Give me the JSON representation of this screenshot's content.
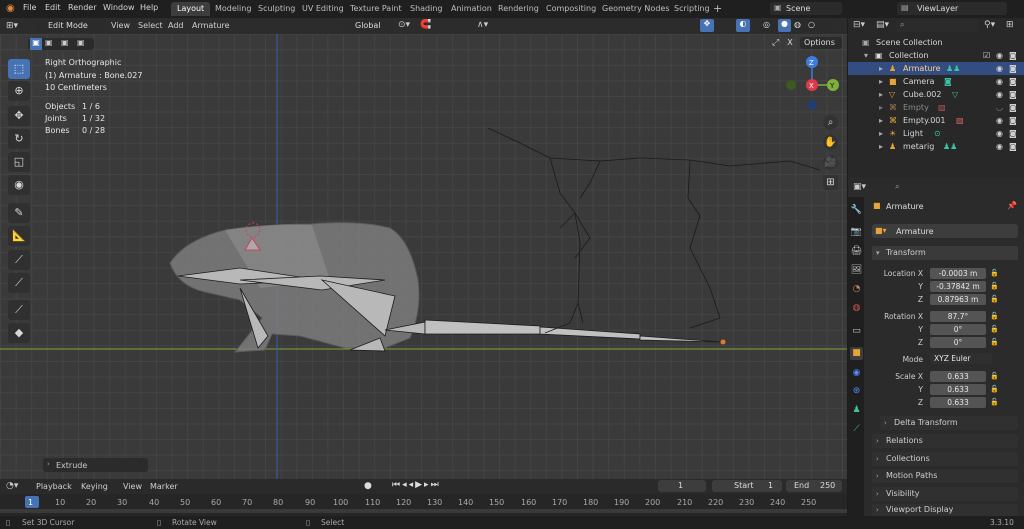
{
  "menu": {
    "file": "File",
    "edit": "Edit",
    "render": "Render",
    "window": "Window",
    "help": "Help"
  },
  "workspaces": [
    "Layout",
    "Modeling",
    "Sculpting",
    "UV Editing",
    "Texture Paint",
    "Shading",
    "Animation",
    "Rendering",
    "Compositing",
    "Geometry Nodes",
    "Scripting"
  ],
  "scene": "Scene",
  "view_layer": "ViewLayer",
  "viewport_header": {
    "mode": "Edit Mode",
    "view": "View",
    "select": "Select",
    "add": "Add",
    "armature": "Armature",
    "orientation": "Global",
    "options": "Options"
  },
  "overlay_info": {
    "view_name": "Right Orthographic",
    "object": "(1) Armature : Bone.027",
    "scale": "10 Centimeters",
    "stats": [
      {
        "label": "Objects",
        "value": "1 / 6"
      },
      {
        "label": "Joints",
        "value": "1 / 32"
      },
      {
        "label": "Bones",
        "value": "0 / 28"
      }
    ]
  },
  "gizmo": {
    "x": "X",
    "y": "Y",
    "z": "Z"
  },
  "last_op": "Extrude",
  "timeline": {
    "playback": "Playback",
    "keying": "Keying",
    "view": "View",
    "marker": "Marker",
    "current": "1",
    "start_label": "Start",
    "start": "1",
    "end_label": "End",
    "end": "250",
    "ticks": [
      "1",
      "10",
      "20",
      "30",
      "40",
      "50",
      "60",
      "70",
      "80",
      "90",
      "100",
      "110",
      "120",
      "130",
      "140",
      "150",
      "160",
      "170",
      "180",
      "190",
      "200",
      "210",
      "220",
      "230",
      "240",
      "250"
    ]
  },
  "status": {
    "left": "Set 3D Cursor",
    "middle": "Rotate View",
    "right": "Select",
    "version": "3.3.10"
  },
  "outliner": {
    "root": "Scene Collection",
    "collection": "Collection",
    "items": [
      {
        "name": "Armature",
        "selected": true
      },
      {
        "name": "Camera",
        "selected": false
      },
      {
        "name": "Cube.002",
        "selected": false
      },
      {
        "name": "Empty",
        "selected": false
      },
      {
        "name": "Empty.001",
        "selected": false
      },
      {
        "name": "Light",
        "selected": false
      },
      {
        "name": "metarig",
        "selected": false
      }
    ]
  },
  "properties": {
    "object_name": "Armature",
    "data_name": "Armature",
    "transform": "Transform",
    "location_label": "Location X",
    "location": [
      "-0.0003 m",
      "-0.37842 m",
      "0.87963 m"
    ],
    "rotation_label": "Rotation X",
    "rotation": [
      "87.7°",
      "0°",
      "0°"
    ],
    "mode_label": "Mode",
    "mode": "XYZ Euler",
    "scale_label": "Scale X",
    "scale": [
      "0.633",
      "0.633",
      "0.633"
    ],
    "y": "Y",
    "z": "Z",
    "panels": [
      "Delta Transform",
      "Relations",
      "Collections",
      "Motion Paths",
      "Visibility",
      "Viewport Display"
    ]
  },
  "colors": {
    "accent": "#4772b3",
    "selected_row": "#334d80",
    "axis_x": "#e0394b",
    "axis_y": "#7eb03a",
    "axis_z": "#3c7be0"
  }
}
